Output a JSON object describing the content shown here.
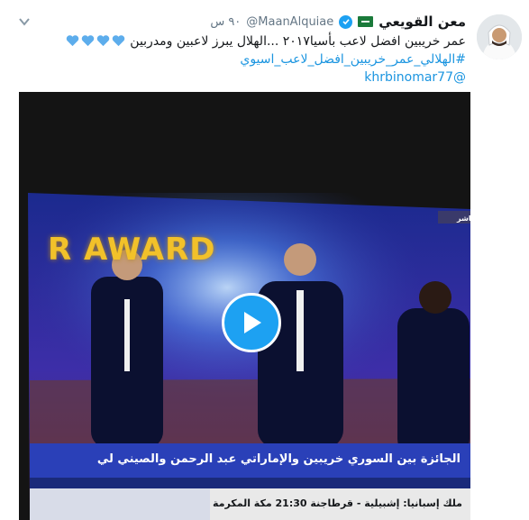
{
  "author": {
    "name": "معن القويعي",
    "handle": "@MaanAlquiae",
    "time": "٩٠ س",
    "flag_icon": "saudi-flag-icon",
    "verified_icon": "verified-badge-icon"
  },
  "tweet": {
    "line1": "عمر خريبين افضل لاعب بأسيا٢٠١٧ ...الهلال يبرز لاعبين ومدربين",
    "hashtag": "#الهلالي_عمر_خريبين_افضل_لاعب_اسيوي",
    "mention": "@khrbinomar77",
    "heart_icon": "blue-heart-icon",
    "heart_count": 4
  },
  "video": {
    "award_text": "R AWARD",
    "live_tag": "مباشر",
    "caption": "الجائزة بين السوري خريبين والإماراتي عبد الرحمن والصيني لي",
    "ticker": "ملك إسبانيا: إشبيلية - قرطاجنة 21:30 مكة المكرمة",
    "play_icon": "play-icon"
  },
  "colors": {
    "link": "#1b95e0",
    "play": "#1da1f2",
    "award": "#f2c12a"
  }
}
